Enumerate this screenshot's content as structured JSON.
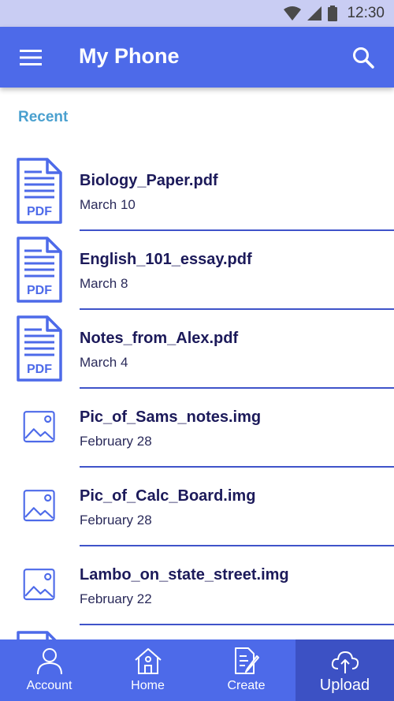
{
  "status_bar": {
    "time": "12:30",
    "icons": [
      "wifi-icon",
      "signal-icon",
      "battery-icon"
    ]
  },
  "app_bar": {
    "title": "My Phone",
    "menu_icon": "menu-icon",
    "search_icon": "search-icon"
  },
  "section": {
    "label": "Recent"
  },
  "files": [
    {
      "name": "Biology_Paper.pdf",
      "date": "March 10",
      "type": "pdf",
      "badge": "PDF"
    },
    {
      "name": "English_101_essay.pdf",
      "date": "March 8",
      "type": "pdf",
      "badge": "PDF"
    },
    {
      "name": "Notes_from_Alex.pdf",
      "date": "March 4",
      "type": "pdf",
      "badge": "PDF"
    },
    {
      "name": "Pic_of_Sams_notes.img",
      "date": "February 28",
      "type": "img"
    },
    {
      "name": "Pic_of_Calc_Board.img",
      "date": "February 28",
      "type": "img"
    },
    {
      "name": "Lambo_on_state_street.img",
      "date": "February 22",
      "type": "img"
    },
    {
      "name": "",
      "date": "",
      "type": "pdf",
      "badge": ""
    }
  ],
  "bottom_nav": {
    "items": [
      {
        "label": "Account",
        "icon": "account-icon"
      },
      {
        "label": "Home",
        "icon": "home-icon"
      },
      {
        "label": "Create",
        "icon": "create-icon"
      },
      {
        "label": "Upload",
        "icon": "upload-cloud-icon",
        "active": true
      }
    ]
  },
  "colors": {
    "primary": "#4d6ae9",
    "primary_dark": "#3c51c4",
    "status_bar": "#c9cdf3",
    "section_label": "#4aa0cf",
    "file_text": "#1c1a5a",
    "icon_stroke": "#4d6ae9"
  }
}
